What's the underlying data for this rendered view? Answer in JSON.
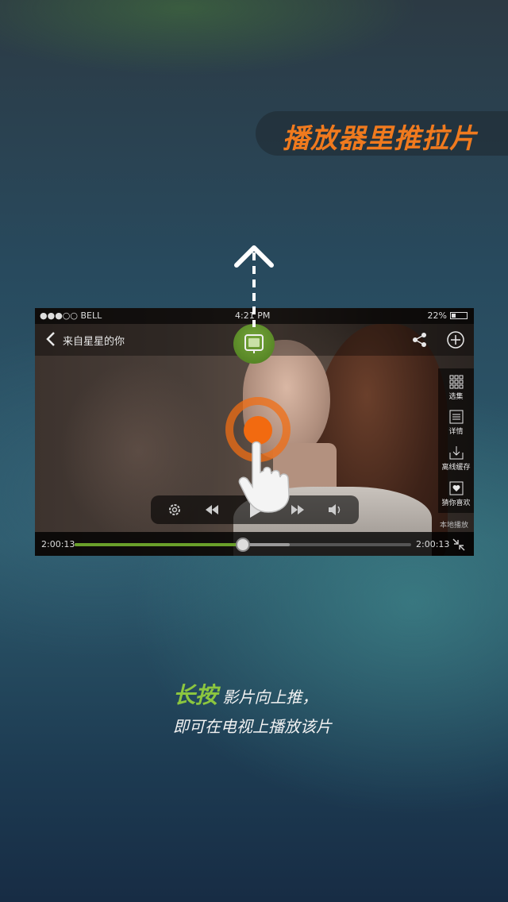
{
  "banner": {
    "title": "播放器里推拉片"
  },
  "player": {
    "status_bar": {
      "carrier": "●●●○○ BELL",
      "time": "4:21 PM",
      "battery": "22%"
    },
    "title": "来自星星的你",
    "side_menu": [
      {
        "label": "选集",
        "icon": "grid-icon"
      },
      {
        "label": "详情",
        "icon": "list-icon"
      },
      {
        "label": "离线缓存",
        "icon": "download-icon"
      },
      {
        "label": "猜你喜欢",
        "icon": "heart-icon"
      }
    ],
    "local_play_label": "本地播放",
    "elapsed": "2:00:13",
    "duration": "2:00:13",
    "progress_fraction": 0.5,
    "buffered_fraction": 0.64
  },
  "caption": {
    "accent": "长按",
    "line1_rest": " 影片向上推，",
    "line2": "即可在电视上播放该片"
  },
  "colors": {
    "accent_orange": "#f07a1e",
    "accent_green": "#8cc63f",
    "progress_green": "#6aa02a"
  }
}
